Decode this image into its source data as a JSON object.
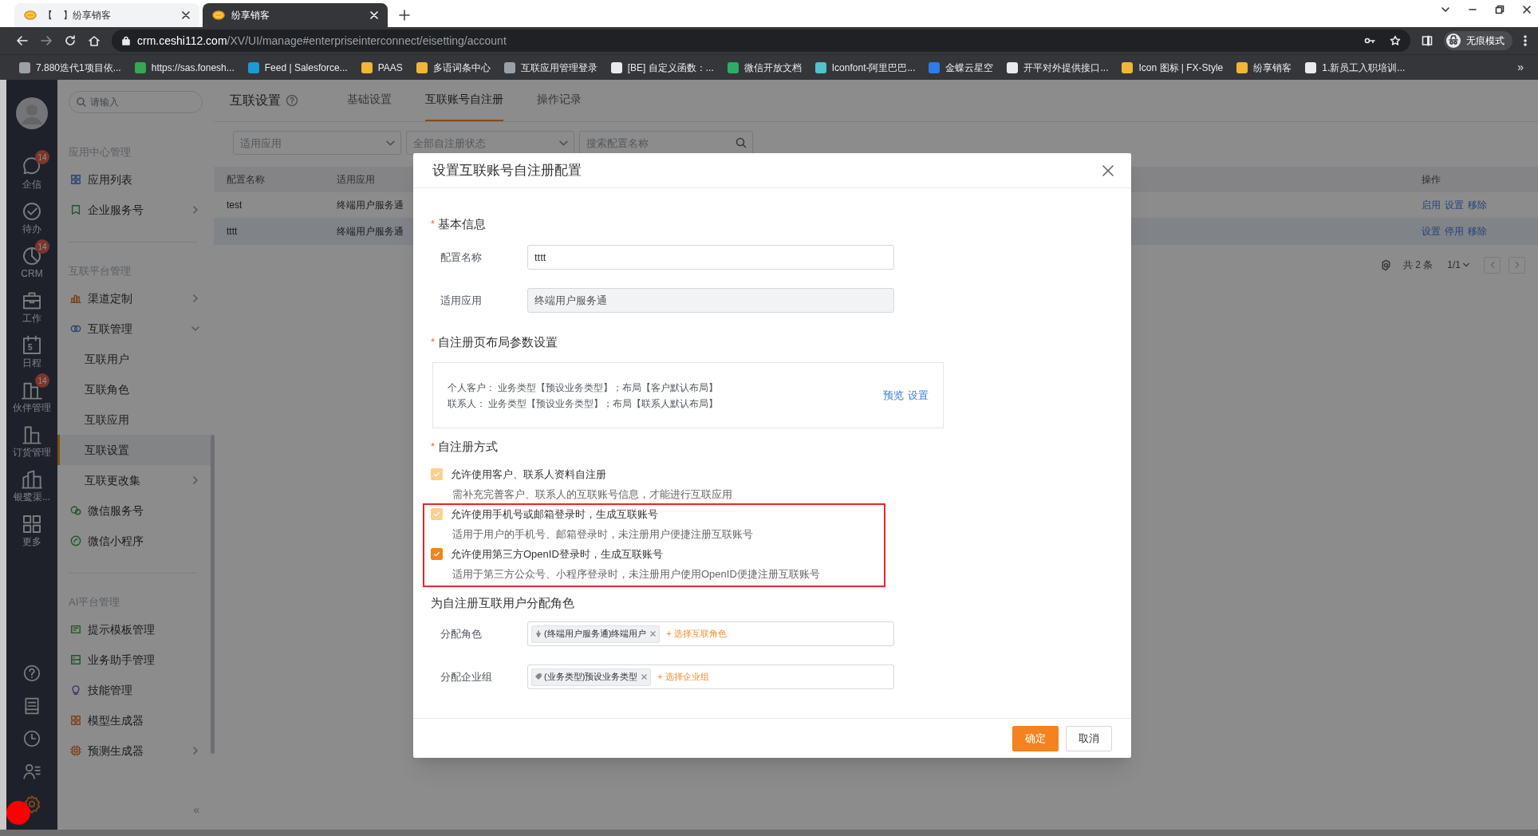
{
  "browser": {
    "tabs": [
      {
        "title": "【    】纷享销客",
        "selected": false
      },
      {
        "title": "纷享销客",
        "selected": true
      }
    ],
    "url_host": "crm.ceshi112.com",
    "url_path": "/XV/UI/manage#enterpriseinterconnect/eisetting/account",
    "profile_label": "无痕模式",
    "bookmarks": [
      {
        "label": "7.880迭代1项目依...",
        "color": "#9aa0a6"
      },
      {
        "label": "https://sas.fonesh...",
        "color": "#34a853"
      },
      {
        "label": "Feed | Salesforce...",
        "color": "#1a9bd7"
      },
      {
        "label": "PAAS",
        "color": "#f2b535"
      },
      {
        "label": "多语词条中心",
        "color": "#f2b535"
      },
      {
        "label": "互联应用管理登录",
        "color": "#9aa0a6"
      },
      {
        "label": "[BE] 自定义函数：...",
        "color": "#e8eaed"
      },
      {
        "label": "微信开放文档",
        "color": "#2aae67"
      },
      {
        "label": "Iconfont-阿里巴巴...",
        "color": "#4fc3c9"
      },
      {
        "label": "金蝶云星空",
        "color": "#2b7de9"
      },
      {
        "label": "开平对外提供接口...",
        "color": "#e8eaed"
      },
      {
        "label": "Icon 图标 | FX-Style",
        "color": "#f2b535"
      },
      {
        "label": "纷享销客",
        "color": "#f2b535"
      },
      {
        "label": "1.新员工入职培训...",
        "color": "#e8eaed"
      }
    ],
    "bookmarks_more": "»"
  },
  "rail": {
    "items": [
      {
        "label": "企信",
        "badge": "14"
      },
      {
        "label": "待办"
      },
      {
        "label": "CRM",
        "badge": "14"
      },
      {
        "label": "工作"
      },
      {
        "label": "日程",
        "icon_text": "5"
      },
      {
        "label": "伙伴管理",
        "badge": "14"
      },
      {
        "label": "订货管理"
      },
      {
        "label": "银鹭渠..."
      },
      {
        "label": "更多"
      }
    ],
    "tools": [
      {
        "selected": false
      },
      {
        "selected": false
      },
      {
        "selected": false
      },
      {
        "selected": false
      },
      {
        "selected": true
      }
    ]
  },
  "sidebar": {
    "search_placeholder": "请输入",
    "collapse": "«",
    "sections": [
      {
        "title": "应用中心管理",
        "items": [
          {
            "label": "应用列表",
            "selected": false
          },
          {
            "label": "企业服务号",
            "selected": false,
            "expanded": false
          }
        ]
      },
      {
        "title": "互联平台管理",
        "items": [
          {
            "label": "渠道定制",
            "selected": false,
            "expanded": false
          },
          {
            "label": "互联管理",
            "selected": false,
            "expanded": true,
            "children": [
              {
                "label": "互联用户",
                "selected": false
              },
              {
                "label": "互联角色",
                "selected": false
              },
              {
                "label": "互联应用",
                "selected": false
              },
              {
                "label": "互联设置",
                "selected": true
              },
              {
                "label": "互联更改集",
                "selected": false,
                "expanded": false
              }
            ]
          },
          {
            "label": "微信服务号",
            "selected": false
          },
          {
            "label": "微信小程序",
            "selected": false
          }
        ]
      },
      {
        "title": "AI平台管理",
        "items": [
          {
            "label": "提示模板管理",
            "selected": false
          },
          {
            "label": "业务助手管理",
            "selected": false
          },
          {
            "label": "技能管理",
            "selected": false
          },
          {
            "label": "模型生成器",
            "selected": false
          },
          {
            "label": "预测生成器",
            "selected": false,
            "expanded": false
          }
        ]
      }
    ]
  },
  "page": {
    "title": "互联设置",
    "tabs": [
      {
        "label": "基础设置",
        "selected": false
      },
      {
        "label": "互联账号自注册",
        "selected": true
      },
      {
        "label": "操作记录",
        "selected": false
      }
    ],
    "filters": [
      {
        "kind": "select",
        "placeholder": "适用应用"
      },
      {
        "kind": "select",
        "placeholder": "全部自注册状态"
      },
      {
        "kind": "search",
        "placeholder": "搜索配置名称"
      }
    ],
    "table": {
      "columns": [
        "配置名称",
        "适用应用",
        "操作"
      ],
      "rows": [
        {
          "cells": [
            "test",
            "终端用户服务通"
          ],
          "actions": [
            "启用",
            "设置",
            "移除"
          ],
          "selected": false
        },
        {
          "cells": [
            "tttt",
            "终端用户服务通"
          ],
          "actions": [
            "设置",
            "停用",
            "移除"
          ],
          "selected": true
        }
      ]
    },
    "pagination": {
      "total": "共 2 条",
      "page": "1/1"
    }
  },
  "modal": {
    "title": "设置互联账号自注册配置",
    "basic": {
      "heading": "基本信息",
      "required_mark": "*",
      "fields": [
        {
          "label": "配置名称",
          "value": "tttt",
          "disabled": false
        },
        {
          "label": "适用应用",
          "value": "终端用户服务通",
          "disabled": true
        }
      ]
    },
    "layout": {
      "heading": "自注册页布局参数设置",
      "required_mark": "*",
      "lines": [
        "个人客户： 业务类型【预设业务类型】；布局【客户默认布局】",
        "联系人： 业务类型【预设业务类型】；布局【联系人默认布局】"
      ],
      "links": [
        "预览",
        "设置"
      ]
    },
    "methods": {
      "heading": "自注册方式",
      "required_mark": "*",
      "options": [
        {
          "label": "允许使用客户、联系人资料自注册",
          "hint": "需补充完善客户、联系人的互联账号信息，才能进行互联应用",
          "checked": true,
          "disabled": true
        },
        {
          "label": "允许使用手机号或邮箱登录时，生成互联账号",
          "hint": "适用于用户的手机号、邮箱登录时，未注册用户便捷注册互联账号",
          "checked": true,
          "disabled": true
        },
        {
          "label": "允许使用第三方OpenID登录时，生成互联账号",
          "hint": "适用于第三方公众号、小程序登录时，未注册用户使用OpenID便捷注册互联账号",
          "checked": true,
          "disabled": false
        }
      ]
    },
    "assign": {
      "heading": "为自注册互联用户分配角色",
      "rows": [
        {
          "label": "分配角色",
          "tag": "(终端用户服务通)终端用户",
          "add": "+ 选择互联角色"
        },
        {
          "label": "分配企业组",
          "tag": "(业务类型)预设业务类型",
          "add": "+ 选择企业组"
        }
      ]
    },
    "buttons": [
      {
        "label": "确定",
        "kind": "primary"
      },
      {
        "label": "取消",
        "kind": "default"
      }
    ]
  }
}
